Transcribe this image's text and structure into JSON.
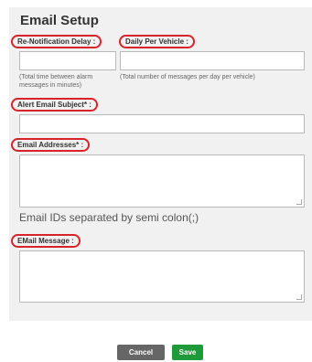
{
  "form": {
    "title": "Email Setup",
    "renotification": {
      "label": "Re-Notification Delay :",
      "value": "",
      "hint": "(Total time between alarm messages in minutes)"
    },
    "daily_per_vehicle": {
      "label": "Daily Per Vehicle :",
      "value": "",
      "hint": "(Total number of messages per day per vehicle)"
    },
    "alert_subject": {
      "label": "Alert Email Subject* :",
      "value": ""
    },
    "email_addresses": {
      "label": "Email Addresses* :",
      "value": "",
      "hint": "Email IDs separated by semi colon(;)"
    },
    "email_message": {
      "label": "EMail Message :",
      "value": ""
    }
  },
  "buttons": {
    "cancel_label": "Cancel",
    "save_label": "Save"
  },
  "colors": {
    "highlight_circle": "#d9232a",
    "save_button": "#1f9a3a",
    "cancel_button": "#666666",
    "panel_background": "#f1f1f1"
  }
}
